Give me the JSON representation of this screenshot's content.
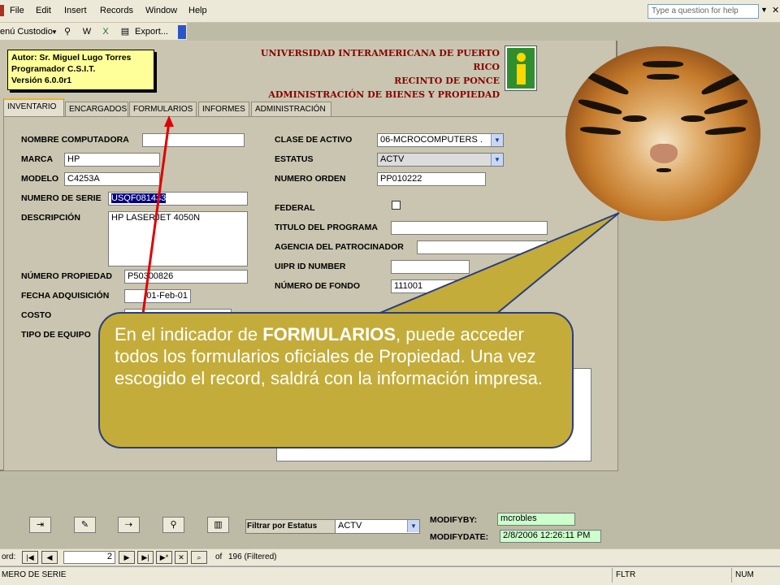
{
  "menu": {
    "file": "File",
    "edit": "Edit",
    "insert": "Insert",
    "records": "Records",
    "window": "Window",
    "help": "Help",
    "help_box": "Type a question for help"
  },
  "toolbar": {
    "menu_custodio": "enú Custodio",
    "export": "Export..."
  },
  "author": {
    "line1": "Autor: Sr. Miguel Lugo Torres",
    "line2": "Programador C.S.I.T.",
    "line3": "Versión 6.0.0r1"
  },
  "university": {
    "line1": "UNIVERSIDAD INTERAMERICANA DE PUERTO RICO",
    "line2": "RECINTO DE PONCE",
    "line3": "ADMINISTRACIÓN DE BIENES Y PROPIEDAD"
  },
  "tabs": [
    "INVENTARIO",
    "ENCARGADOS",
    "FORMULARIOS",
    "INFORMES",
    "ADMINISTRACIÓN"
  ],
  "left_form": {
    "nombre_computadora": {
      "label": "NOMBRE COMPUTADORA",
      "value": ""
    },
    "marca": {
      "label": "MARCA",
      "value": "HP"
    },
    "modelo": {
      "label": "MODELO",
      "value": "C4253A"
    },
    "numero_serie": {
      "label": "NUMERO DE SERIE",
      "value": "USQF081433"
    },
    "descripcion": {
      "label": "DESCRIPCIÓN",
      "value": "HP LASERJET 4050N"
    },
    "numero_propiedad": {
      "label": "NÚMERO PROPIEDAD",
      "value": "P50300826"
    },
    "fecha_adquisicion": {
      "label": "FECHA ADQUISICIÓN",
      "value": "01-Feb-01"
    },
    "costo": {
      "label": "COSTO",
      "value": ""
    },
    "tipo_equipo": {
      "label": "TIPO DE EQUIPO",
      "value": ""
    }
  },
  "right_form": {
    "clase_activo": {
      "label": "CLASE DE ACTIVO",
      "value": "06-MCROCOMPUTERS ."
    },
    "estatus": {
      "label": "ESTATUS",
      "value": "ACTV"
    },
    "numero_orden": {
      "label": "NUMERO ORDEN",
      "value": "PP010222"
    },
    "federal": {
      "label": "FEDERAL",
      "checked": false
    },
    "titulo_programa": {
      "label": "TITULO DEL PROGRAMA",
      "value": ""
    },
    "agencia": {
      "label": "AGENCIA DEL PATROCINADOR",
      "value": ""
    },
    "uipr_id": {
      "label": "UIPR ID NUMBER",
      "value": ""
    },
    "numero_fondo": {
      "label": "NÚMERO DE FONDO",
      "value": "111001"
    }
  },
  "callout": {
    "pre": "En el indicador de ",
    "highlight": "FORMULARIOS",
    "post": ", puede acceder todos los formularios oficiales de Propiedad.  Una vez escogido el record, saldrá con la información impresa."
  },
  "bottom": {
    "filter_label": "Filtrar por Estatus",
    "filter_value": "ACTV",
    "modifyby_label": "MODIFYBY:",
    "modifyby_value": "mcrobles",
    "modifydate_label": "MODIFYDATE:",
    "modifydate_value": "2/8/2006 12:26:11 PM"
  },
  "record_nav": {
    "label": "ord:",
    "current": "2",
    "of_text": "of",
    "total": "196 (Filtered)"
  },
  "status_bar": {
    "text": "MERO DE SERIE",
    "fltr": "FLTR",
    "num": "NUM"
  },
  "colors": {
    "callout_fill": "#c4ac3a",
    "arrow_red": "#e00000",
    "form_bg": "#c9c5b0"
  }
}
